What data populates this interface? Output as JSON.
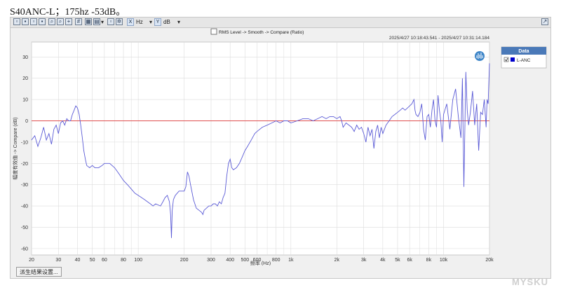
{
  "page": {
    "title": "S40ANC-L；175hz  -53dB。"
  },
  "toolbar": {
    "x_axis_unit": "Hz",
    "y_axis_unit": "dB",
    "x_label_short": "X",
    "y_label_short": "Y"
  },
  "chart": {
    "process_chain": "RMS Level -> Smooth -> Compare (Ratio)",
    "timestamp_range": "2025/4/27 10:18:43.541 - 2025/4/27 10:31:14.184"
  },
  "legend": {
    "header": "Data",
    "items": [
      {
        "label": "L-ANC",
        "color": "#0000cc",
        "checked": true
      }
    ]
  },
  "status_bar": {
    "button_label": "派生结果设置..."
  },
  "watermark": "MYSKU",
  "colors": {
    "trace": "#5b5bd6",
    "reference": "#e05050",
    "grid": "#dcdcdc",
    "legend_header": "#4a79b8"
  },
  "chart_data": {
    "type": "line",
    "xlabel": "频率 (Hz)",
    "ylabel": "幅度有效值 -> Compare (dB)",
    "x_scale": "log",
    "xlim": [
      20,
      20000
    ],
    "ylim": [
      -63,
      37
    ],
    "grid": true,
    "legend_position": "top-right",
    "x_ticks": [
      {
        "v": 20,
        "label": "20"
      },
      {
        "v": 30,
        "label": "30"
      },
      {
        "v": 40,
        "label": "40"
      },
      {
        "v": 50,
        "label": "50"
      },
      {
        "v": 60,
        "label": "60"
      },
      {
        "v": 80,
        "label": "80"
      },
      {
        "v": 100,
        "label": "100"
      },
      {
        "v": 200,
        "label": "200"
      },
      {
        "v": 300,
        "label": "300"
      },
      {
        "v": 400,
        "label": "400"
      },
      {
        "v": 500,
        "label": "500"
      },
      {
        "v": 600,
        "label": "600"
      },
      {
        "v": 800,
        "label": "800"
      },
      {
        "v": 1000,
        "label": "1k"
      },
      {
        "v": 2000,
        "label": "2k"
      },
      {
        "v": 3000,
        "label": "3k"
      },
      {
        "v": 4000,
        "label": "4k"
      },
      {
        "v": 5000,
        "label": "5k"
      },
      {
        "v": 6000,
        "label": "6k"
      },
      {
        "v": 8000,
        "label": "8k"
      },
      {
        "v": 10000,
        "label": "10k"
      },
      {
        "v": 20000,
        "label": "20k"
      }
    ],
    "x_minor_grid": [
      70,
      90,
      700,
      900,
      7000,
      9000
    ],
    "y_ticks": [
      30,
      20,
      10,
      0,
      -10,
      -20,
      -30,
      -40,
      -50,
      -60
    ],
    "reference_line": 0,
    "series": [
      {
        "name": "L-ANC",
        "points": [
          [
            20,
            -9
          ],
          [
            21,
            -7
          ],
          [
            22,
            -12
          ],
          [
            23,
            -8
          ],
          [
            24,
            -3
          ],
          [
            25,
            -9
          ],
          [
            26,
            -6
          ],
          [
            27,
            -11
          ],
          [
            28,
            -4
          ],
          [
            29,
            -2
          ],
          [
            30,
            -6
          ],
          [
            31,
            -1
          ],
          [
            32,
            0
          ],
          [
            33,
            -2
          ],
          [
            34,
            1
          ],
          [
            35,
            0
          ],
          [
            36,
            0
          ],
          [
            37,
            3
          ],
          [
            38,
            5
          ],
          [
            39,
            7
          ],
          [
            40,
            6
          ],
          [
            41,
            3
          ],
          [
            42,
            -2
          ],
          [
            43,
            -8
          ],
          [
            44,
            -14
          ],
          [
            45,
            -18
          ],
          [
            46,
            -21
          ],
          [
            48,
            -22
          ],
          [
            50,
            -21
          ],
          [
            52,
            -22
          ],
          [
            55,
            -22
          ],
          [
            58,
            -21
          ],
          [
            60,
            -20
          ],
          [
            65,
            -20
          ],
          [
            70,
            -22
          ],
          [
            75,
            -25
          ],
          [
            80,
            -28
          ],
          [
            85,
            -30
          ],
          [
            90,
            -32
          ],
          [
            95,
            -34
          ],
          [
            100,
            -35
          ],
          [
            110,
            -37
          ],
          [
            120,
            -39
          ],
          [
            125,
            -40
          ],
          [
            130,
            -39
          ],
          [
            140,
            -40
          ],
          [
            145,
            -38
          ],
          [
            150,
            -36
          ],
          [
            155,
            -35
          ],
          [
            160,
            -38
          ],
          [
            163,
            -44
          ],
          [
            165,
            -55
          ],
          [
            167,
            -42
          ],
          [
            170,
            -37
          ],
          [
            175,
            -35
          ],
          [
            180,
            -34
          ],
          [
            185,
            -33
          ],
          [
            190,
            -33
          ],
          [
            200,
            -33
          ],
          [
            205,
            -31
          ],
          [
            210,
            -24
          ],
          [
            215,
            -26
          ],
          [
            220,
            -30
          ],
          [
            230,
            -37
          ],
          [
            240,
            -41
          ],
          [
            250,
            -42
          ],
          [
            260,
            -43
          ],
          [
            265,
            -44
          ],
          [
            270,
            -42
          ],
          [
            280,
            -41
          ],
          [
            290,
            -40
          ],
          [
            300,
            -40
          ],
          [
            310,
            -39
          ],
          [
            320,
            -39
          ],
          [
            330,
            -40
          ],
          [
            340,
            -38
          ],
          [
            350,
            -39
          ],
          [
            360,
            -36
          ],
          [
            370,
            -34
          ],
          [
            380,
            -26
          ],
          [
            390,
            -20
          ],
          [
            400,
            -18
          ],
          [
            410,
            -22
          ],
          [
            420,
            -23
          ],
          [
            440,
            -22
          ],
          [
            460,
            -20
          ],
          [
            480,
            -17
          ],
          [
            500,
            -14
          ],
          [
            520,
            -12
          ],
          [
            550,
            -9
          ],
          [
            580,
            -6
          ],
          [
            600,
            -5
          ],
          [
            650,
            -3
          ],
          [
            700,
            -2
          ],
          [
            750,
            -1
          ],
          [
            800,
            0
          ],
          [
            850,
            -1
          ],
          [
            900,
            0
          ],
          [
            950,
            0
          ],
          [
            1000,
            -1
          ],
          [
            1100,
            0
          ],
          [
            1200,
            1
          ],
          [
            1300,
            1
          ],
          [
            1400,
            0
          ],
          [
            1500,
            1
          ],
          [
            1600,
            2
          ],
          [
            1700,
            1
          ],
          [
            1800,
            2
          ],
          [
            1900,
            2
          ],
          [
            2000,
            1
          ],
          [
            2100,
            2
          ],
          [
            2150,
            0
          ],
          [
            2200,
            -3
          ],
          [
            2300,
            -1
          ],
          [
            2400,
            -2
          ],
          [
            2500,
            -3
          ],
          [
            2600,
            -5
          ],
          [
            2700,
            -2
          ],
          [
            2800,
            -4
          ],
          [
            2900,
            -3
          ],
          [
            3000,
            -6
          ],
          [
            3100,
            -10
          ],
          [
            3200,
            -3
          ],
          [
            3300,
            -7
          ],
          [
            3400,
            -4
          ],
          [
            3500,
            -13
          ],
          [
            3600,
            -5
          ],
          [
            3700,
            -2
          ],
          [
            3800,
            -8
          ],
          [
            3900,
            -3
          ],
          [
            4000,
            -6
          ],
          [
            4200,
            -2
          ],
          [
            4400,
            0
          ],
          [
            4600,
            2
          ],
          [
            4800,
            3
          ],
          [
            5000,
            4
          ],
          [
            5200,
            5
          ],
          [
            5400,
            6
          ],
          [
            5600,
            5
          ],
          [
            5800,
            6
          ],
          [
            6000,
            7
          ],
          [
            6200,
            8
          ],
          [
            6400,
            10
          ],
          [
            6500,
            5
          ],
          [
            6600,
            3
          ],
          [
            6800,
            2
          ],
          [
            7000,
            4
          ],
          [
            7200,
            8
          ],
          [
            7400,
            -4
          ],
          [
            7600,
            -9
          ],
          [
            7800,
            2
          ],
          [
            8000,
            3
          ],
          [
            8200,
            -3
          ],
          [
            8400,
            5
          ],
          [
            8600,
            10
          ],
          [
            8800,
            0
          ],
          [
            9000,
            -3
          ],
          [
            9200,
            12
          ],
          [
            9400,
            5
          ],
          [
            9600,
            0
          ],
          [
            9800,
            -10
          ],
          [
            10000,
            3
          ],
          [
            10500,
            8
          ],
          [
            11000,
            -4
          ],
          [
            11500,
            10
          ],
          [
            12000,
            15
          ],
          [
            12500,
            2
          ],
          [
            13000,
            -8
          ],
          [
            13300,
            20
          ],
          [
            13600,
            -31
          ],
          [
            14000,
            23
          ],
          [
            14300,
            5
          ],
          [
            14600,
            -2
          ],
          [
            15000,
            4
          ],
          [
            15500,
            14
          ],
          [
            16000,
            -2
          ],
          [
            16500,
            8
          ],
          [
            17000,
            -14
          ],
          [
            17500,
            4
          ],
          [
            18000,
            3
          ],
          [
            18500,
            10
          ],
          [
            19000,
            -3
          ],
          [
            19300,
            10
          ],
          [
            19600,
            8
          ],
          [
            20000,
            27
          ]
        ]
      }
    ]
  }
}
